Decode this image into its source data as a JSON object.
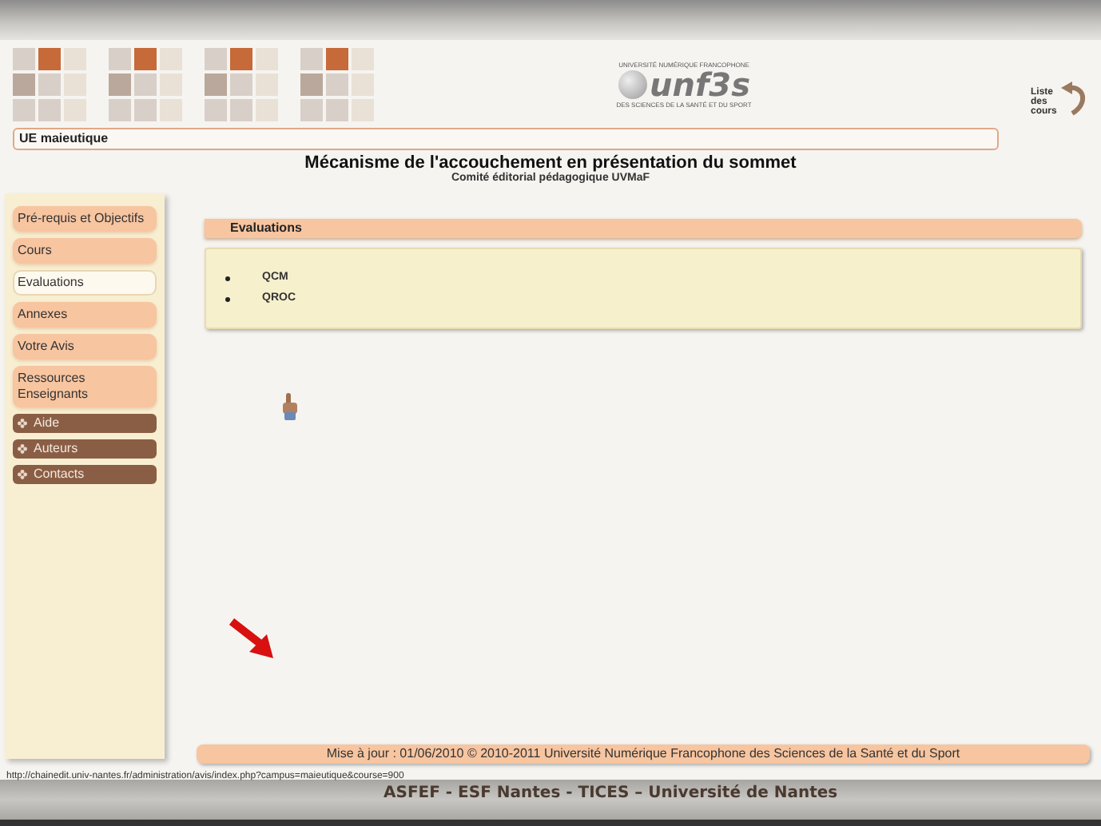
{
  "banner": {
    "logo": {
      "top_text": "UNIVERSITÉ NUMÉRIQUE FRANCOPHONE",
      "name": "unf3s",
      "bottom_text": "DES SCIENCES DE LA SANTÉ ET DU SPORT"
    },
    "course_list_link": "Liste des cours"
  },
  "ue_bar": "UE maieutique",
  "title": "Mécanisme de l'accouchement en présentation du sommet",
  "subtitle": "Comité éditorial pédagogique UVMaF",
  "sidebar": {
    "items": [
      {
        "label": "Pré-requis et Objectifs",
        "kind": "section",
        "selected": false
      },
      {
        "label": "Cours",
        "kind": "section",
        "selected": false
      },
      {
        "label": "Evaluations",
        "kind": "section",
        "selected": true
      },
      {
        "label": "Annexes",
        "kind": "section",
        "selected": false
      },
      {
        "label": "Votre Avis",
        "kind": "section",
        "selected": false
      },
      {
        "label": "Ressources Enseignants",
        "kind": "section",
        "selected": false
      },
      {
        "label": "Aide",
        "kind": "link",
        "selected": false
      },
      {
        "label": "Auteurs",
        "kind": "link",
        "selected": false
      },
      {
        "label": "Contacts",
        "kind": "link",
        "selected": false
      }
    ]
  },
  "section": {
    "title": "Evaluations",
    "items": [
      "QCM",
      "QROC"
    ]
  },
  "footer": "Mise à jour : 01/06/2010 © 2010-2011 Université Numérique Francophone des Sciences de la Santé et du Sport",
  "status_url": "http://chainedit.univ-nantes.fr/administration/avis/index.php?campus=maieutique&course=900",
  "caption": "ASFEF - ESF Nantes - TICES – Université de Nantes"
}
